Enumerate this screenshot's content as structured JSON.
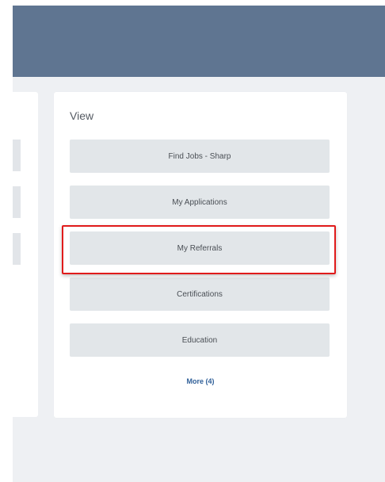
{
  "view": {
    "title": "View",
    "buttons": [
      {
        "label": "Find Jobs - Sharp"
      },
      {
        "label": "My Applications"
      },
      {
        "label": "My Referrals"
      },
      {
        "label": "Certifications"
      },
      {
        "label": "Education"
      }
    ],
    "more_link": "More (4)",
    "highlight_color": "#e01b1b"
  },
  "colors": {
    "header": "#5f7591",
    "background": "#eef0f3",
    "button": "#e2e6e9",
    "link": "#2f5f98"
  }
}
